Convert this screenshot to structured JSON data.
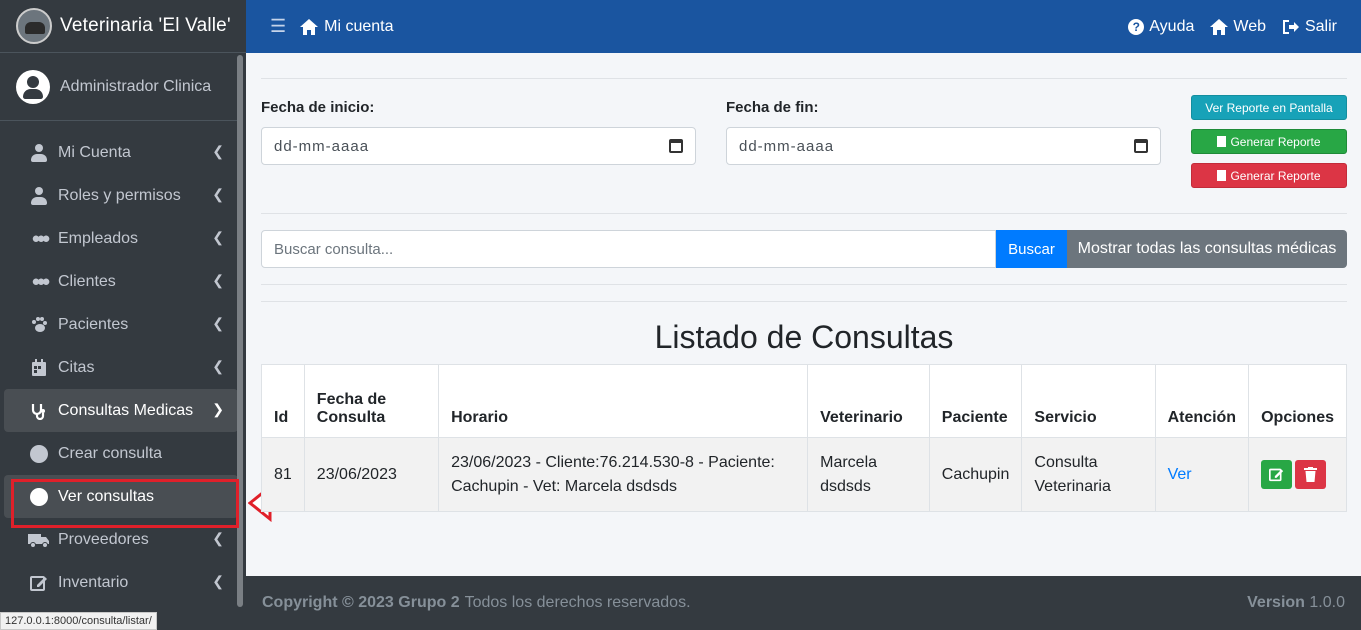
{
  "sidebar": {
    "brand": "Veterinaria 'El Valle'",
    "user": "Administrador Clinica",
    "items": [
      {
        "label": "Mi Cuenta"
      },
      {
        "label": "Roles y permisos"
      },
      {
        "label": "Empleados"
      },
      {
        "label": "Clientes"
      },
      {
        "label": "Pacientes"
      },
      {
        "label": "Citas"
      },
      {
        "label": "Consultas Medicas"
      },
      {
        "label": "Crear consulta"
      },
      {
        "label": "Ver consultas"
      },
      {
        "label": "Proveedores"
      },
      {
        "label": "Inventario"
      }
    ],
    "status_url": "127.0.0.1:8000/consulta/listar/"
  },
  "topbar": {
    "title": "Mi cuenta",
    "help": "Ayuda",
    "web": "Web",
    "logout": "Salir"
  },
  "filters": {
    "start_label": "Fecha de inicio:",
    "end_label": "Fecha de fin:",
    "start_placeholder": "dd-mm-aaaa",
    "end_placeholder": "dd-mm-aaaa",
    "btn_screen": "Ver Reporte en Pantalla",
    "btn_excel": "Generar Reporte",
    "btn_pdf": "Generar Reporte"
  },
  "search": {
    "placeholder": "Buscar consulta...",
    "btn_search": "Buscar",
    "btn_all": "Mostrar todas las consultas médicas"
  },
  "list_title": "Listado de Consultas",
  "table": {
    "headers": [
      "Id",
      "Fecha de Consulta",
      "Horario",
      "Veterinario",
      "Paciente",
      "Servicio",
      "Atención",
      "Opciones"
    ],
    "rows": [
      {
        "id": "81",
        "fecha": "23/06/2023",
        "horario": "23/06/2023 - Cliente:76.214.530-8 - Paciente: Cachupin - Vet: Marcela dsdsds",
        "veterinario": "Marcela dsdsds",
        "paciente": "Cachupin",
        "servicio": "Consulta Veterinaria",
        "atencion": "Ver"
      }
    ]
  },
  "footer": {
    "copyright": "Copyright © 2023 Grupo 2",
    "rights": "Todos los derechos reservados.",
    "version_label": "Version",
    "version": "1.0.0"
  },
  "colors": {
    "topbar": "#1a55a0",
    "sidebar": "#343a40",
    "highlight": "#e0202a"
  }
}
